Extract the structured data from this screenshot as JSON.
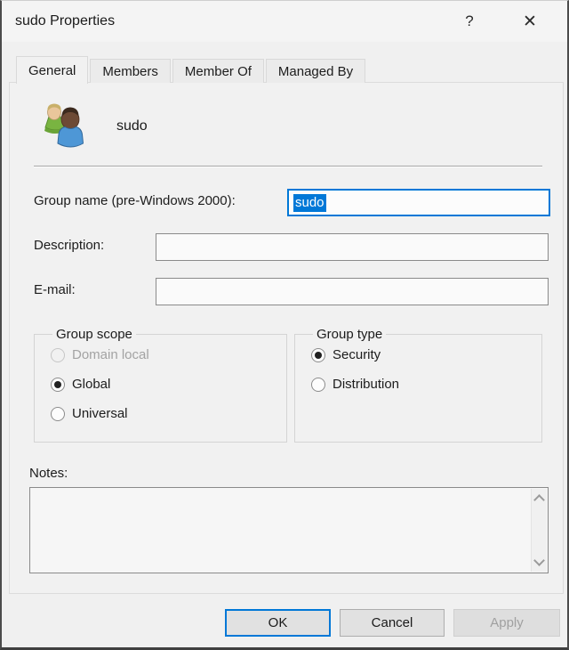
{
  "window": {
    "title": "sudo Properties",
    "help_glyph": "?",
    "close_glyph": "✕"
  },
  "colors": {
    "accent": "#0078d7",
    "selection_bg": "#0078d7",
    "selection_text": "#ffffff"
  },
  "icons": {
    "group": "two-users-group-icon",
    "help": "help-icon",
    "close": "close-icon",
    "notes_scroll_up": "chevron-up-icon",
    "notes_scroll_down": "chevron-down-icon"
  },
  "tabs": [
    {
      "label": "General",
      "active": true
    },
    {
      "label": "Members",
      "active": false
    },
    {
      "label": "Member Of",
      "active": false
    },
    {
      "label": "Managed By",
      "active": false
    }
  ],
  "general": {
    "identity": {
      "display_name": "sudo"
    },
    "fields": {
      "group_name": {
        "label": "Group name (pre-Windows 2000):",
        "value": "sudo",
        "selected": true,
        "focused": true
      },
      "description": {
        "label": "Description:",
        "value": ""
      },
      "email": {
        "label": "E-mail:",
        "value": ""
      }
    },
    "group_scope": {
      "legend": "Group scope",
      "options": [
        {
          "label": "Domain local",
          "selected": false,
          "disabled": true
        },
        {
          "label": "Global",
          "selected": true,
          "disabled": false
        },
        {
          "label": "Universal",
          "selected": false,
          "disabled": false
        }
      ]
    },
    "group_type": {
      "legend": "Group type",
      "options": [
        {
          "label": "Security",
          "selected": true,
          "disabled": false
        },
        {
          "label": "Distribution",
          "selected": false,
          "disabled": false
        }
      ]
    },
    "notes": {
      "label": "Notes:",
      "value": ""
    }
  },
  "buttons": {
    "ok": {
      "label": "OK",
      "default": true,
      "enabled": true
    },
    "cancel": {
      "label": "Cancel",
      "enabled": true
    },
    "apply": {
      "label": "Apply",
      "enabled": false
    }
  }
}
